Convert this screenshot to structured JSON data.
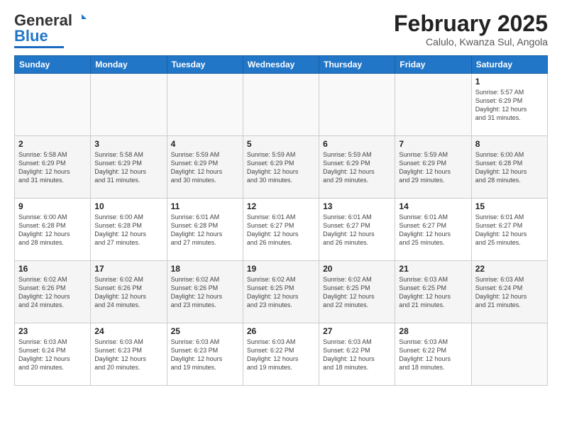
{
  "logo": {
    "general": "General",
    "blue": "Blue"
  },
  "header": {
    "month": "February 2025",
    "location": "Calulo, Kwanza Sul, Angola"
  },
  "weekdays": [
    "Sunday",
    "Monday",
    "Tuesday",
    "Wednesday",
    "Thursday",
    "Friday",
    "Saturday"
  ],
  "weeks": [
    [
      {
        "day": "",
        "info": ""
      },
      {
        "day": "",
        "info": ""
      },
      {
        "day": "",
        "info": ""
      },
      {
        "day": "",
        "info": ""
      },
      {
        "day": "",
        "info": ""
      },
      {
        "day": "",
        "info": ""
      },
      {
        "day": "1",
        "info": "Sunrise: 5:57 AM\nSunset: 6:29 PM\nDaylight: 12 hours\nand 31 minutes."
      }
    ],
    [
      {
        "day": "2",
        "info": "Sunrise: 5:58 AM\nSunset: 6:29 PM\nDaylight: 12 hours\nand 31 minutes."
      },
      {
        "day": "3",
        "info": "Sunrise: 5:58 AM\nSunset: 6:29 PM\nDaylight: 12 hours\nand 31 minutes."
      },
      {
        "day": "4",
        "info": "Sunrise: 5:59 AM\nSunset: 6:29 PM\nDaylight: 12 hours\nand 30 minutes."
      },
      {
        "day": "5",
        "info": "Sunrise: 5:59 AM\nSunset: 6:29 PM\nDaylight: 12 hours\nand 30 minutes."
      },
      {
        "day": "6",
        "info": "Sunrise: 5:59 AM\nSunset: 6:29 PM\nDaylight: 12 hours\nand 29 minutes."
      },
      {
        "day": "7",
        "info": "Sunrise: 5:59 AM\nSunset: 6:29 PM\nDaylight: 12 hours\nand 29 minutes."
      },
      {
        "day": "8",
        "info": "Sunrise: 6:00 AM\nSunset: 6:28 PM\nDaylight: 12 hours\nand 28 minutes."
      }
    ],
    [
      {
        "day": "9",
        "info": "Sunrise: 6:00 AM\nSunset: 6:28 PM\nDaylight: 12 hours\nand 28 minutes."
      },
      {
        "day": "10",
        "info": "Sunrise: 6:00 AM\nSunset: 6:28 PM\nDaylight: 12 hours\nand 27 minutes."
      },
      {
        "day": "11",
        "info": "Sunrise: 6:01 AM\nSunset: 6:28 PM\nDaylight: 12 hours\nand 27 minutes."
      },
      {
        "day": "12",
        "info": "Sunrise: 6:01 AM\nSunset: 6:27 PM\nDaylight: 12 hours\nand 26 minutes."
      },
      {
        "day": "13",
        "info": "Sunrise: 6:01 AM\nSunset: 6:27 PM\nDaylight: 12 hours\nand 26 minutes."
      },
      {
        "day": "14",
        "info": "Sunrise: 6:01 AM\nSunset: 6:27 PM\nDaylight: 12 hours\nand 25 minutes."
      },
      {
        "day": "15",
        "info": "Sunrise: 6:01 AM\nSunset: 6:27 PM\nDaylight: 12 hours\nand 25 minutes."
      }
    ],
    [
      {
        "day": "16",
        "info": "Sunrise: 6:02 AM\nSunset: 6:26 PM\nDaylight: 12 hours\nand 24 minutes."
      },
      {
        "day": "17",
        "info": "Sunrise: 6:02 AM\nSunset: 6:26 PM\nDaylight: 12 hours\nand 24 minutes."
      },
      {
        "day": "18",
        "info": "Sunrise: 6:02 AM\nSunset: 6:26 PM\nDaylight: 12 hours\nand 23 minutes."
      },
      {
        "day": "19",
        "info": "Sunrise: 6:02 AM\nSunset: 6:25 PM\nDaylight: 12 hours\nand 23 minutes."
      },
      {
        "day": "20",
        "info": "Sunrise: 6:02 AM\nSunset: 6:25 PM\nDaylight: 12 hours\nand 22 minutes."
      },
      {
        "day": "21",
        "info": "Sunrise: 6:03 AM\nSunset: 6:25 PM\nDaylight: 12 hours\nand 21 minutes."
      },
      {
        "day": "22",
        "info": "Sunrise: 6:03 AM\nSunset: 6:24 PM\nDaylight: 12 hours\nand 21 minutes."
      }
    ],
    [
      {
        "day": "23",
        "info": "Sunrise: 6:03 AM\nSunset: 6:24 PM\nDaylight: 12 hours\nand 20 minutes."
      },
      {
        "day": "24",
        "info": "Sunrise: 6:03 AM\nSunset: 6:23 PM\nDaylight: 12 hours\nand 20 minutes."
      },
      {
        "day": "25",
        "info": "Sunrise: 6:03 AM\nSunset: 6:23 PM\nDaylight: 12 hours\nand 19 minutes."
      },
      {
        "day": "26",
        "info": "Sunrise: 6:03 AM\nSunset: 6:22 PM\nDaylight: 12 hours\nand 19 minutes."
      },
      {
        "day": "27",
        "info": "Sunrise: 6:03 AM\nSunset: 6:22 PM\nDaylight: 12 hours\nand 18 minutes."
      },
      {
        "day": "28",
        "info": "Sunrise: 6:03 AM\nSunset: 6:22 PM\nDaylight: 12 hours\nand 18 minutes."
      },
      {
        "day": "",
        "info": ""
      }
    ]
  ]
}
